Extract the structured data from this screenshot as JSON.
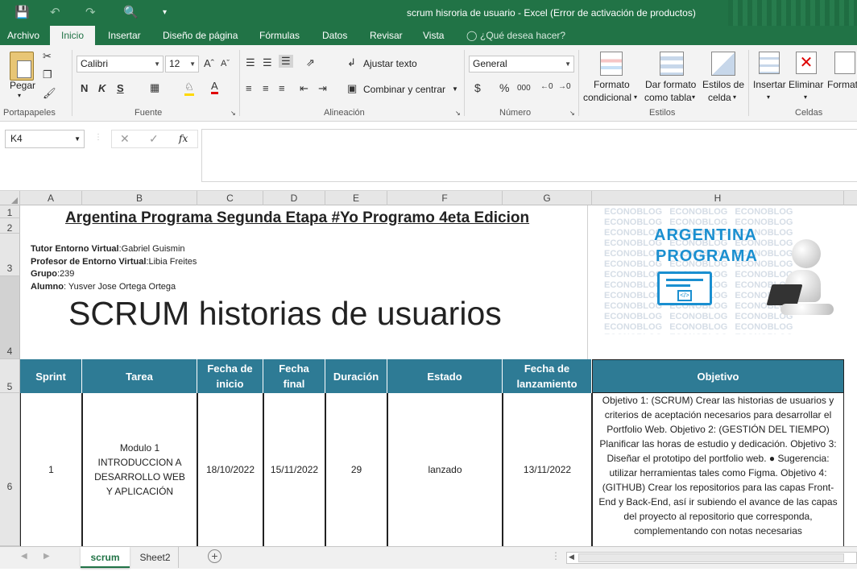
{
  "window": {
    "title": "scrum hisroria de usuario - Excel (Error de activación de productos)"
  },
  "tabs": [
    "Archivo",
    "Inicio",
    "Insertar",
    "Diseño de página",
    "Fórmulas",
    "Datos",
    "Revisar",
    "Vista"
  ],
  "tell_me": "¿Qué desea hacer?",
  "ribbon": {
    "paste_label": "Pegar",
    "font_name": "Calibri",
    "font_size": "12",
    "bold": "N",
    "italic": "K",
    "underline": "S",
    "wrap_text": "Ajustar texto",
    "merge_center": "Combinar y centrar",
    "number_format": "General",
    "currency": "$",
    "percent": "%",
    "thousands": "000",
    "cond_format_1": "Formato",
    "cond_format_2": "condicional",
    "format_table_1": "Dar formato",
    "format_table_2": "como tabla",
    "cell_styles_1": "Estilos de",
    "cell_styles_2": "celda",
    "insert": "Insertar",
    "delete": "Eliminar",
    "format": "Formato",
    "groups": {
      "clipboard": "Portapapeles",
      "font": "Fuente",
      "alignment": "Alineación",
      "number": "Número",
      "styles": "Estilos",
      "cells": "Celdas"
    }
  },
  "formula_bar": {
    "name_box": "K4",
    "fx": "fx",
    "formula": ""
  },
  "columns": [
    "A",
    "B",
    "C",
    "D",
    "E",
    "F",
    "G",
    "H"
  ],
  "rows": [
    "1",
    "2",
    "3",
    "4",
    "5",
    "6"
  ],
  "sheet": {
    "title": "Argentina Programa Segunda Etapa  #Yo Programo 4eta Edicion",
    "info": [
      {
        "label": "Tutor Entorno Virtual",
        "value": ":Gabriel Guismin"
      },
      {
        "label": "Profesor de Entorno Virtual",
        "value": ":Libia Freites"
      },
      {
        "label": "Grupo",
        "value": ":239"
      },
      {
        "label": "Alumno",
        "value": ": Yusver Jose Ortega Ortega"
      }
    ],
    "big_title": "SCRUM  historias de usuarios",
    "logo": {
      "line1": "ARGENTINA",
      "line2": "PROGRAMA",
      "watermark": "ECONOBLOG"
    },
    "headers": [
      "Sprint",
      "Tarea",
      "Fecha de inicio",
      "Fecha final",
      "Duración",
      "Estado",
      "Fecha de lanzamiento",
      "Objetivo"
    ],
    "row6": {
      "sprint": "1",
      "tarea": "Modulo 1 INTRODUCCION A DESARROLLO WEB Y APLICACIÓN",
      "inicio": "18/10/2022",
      "final": "15/11/2022",
      "duracion": "29",
      "estado": "lanzado",
      "lanzamiento": "13/11/2022",
      "objetivo": "Objetivo 1: (SCRUM) Crear las historias de usuarios y criterios de aceptación necesarios para desarrollar el Portfolio Web. Objetivo 2: (GESTIÓN DEL TIEMPO) Planificar las horas de estudio y dedicación. Objetivo 3: Diseñar el prototipo del portfolio web. ● Sugerencia: utilizar herramientas tales como Figma. Objetivo 4: (GITHUB) Crear los repositorios para las capas Front-End y Back-End, así ir subiendo el avance de las capas del proyecto al repositorio que corresponda, complementando con notas necesarias"
    }
  },
  "sheet_tabs": [
    "scrum",
    "Sheet2"
  ],
  "colors": {
    "excel_green": "#217346",
    "header_teal": "#2e7b95"
  }
}
